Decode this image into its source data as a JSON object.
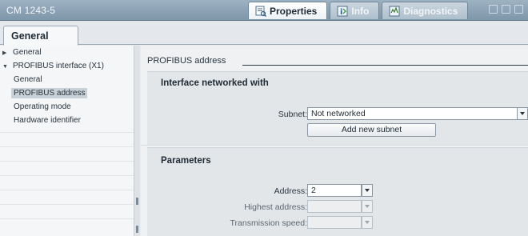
{
  "titlebar": {
    "module": "CM 1243-5",
    "tabs": [
      {
        "label": "Properties",
        "icon": "properties-icon",
        "active": true
      },
      {
        "label": "Info",
        "icon": "info-icon",
        "active": false
      },
      {
        "label": "Diagnostics",
        "icon": "diagnostics-icon",
        "active": false
      }
    ]
  },
  "tabstrip": {
    "general_tab": "General"
  },
  "nav": {
    "items": [
      {
        "label": "General",
        "level": 0,
        "arrow": "▶",
        "selected": false
      },
      {
        "label": "PROFIBUS interface (X1)",
        "level": 0,
        "arrow": "▼",
        "selected": false
      },
      {
        "label": "General",
        "level": 1,
        "selected": false
      },
      {
        "label": "PROFIBUS address",
        "level": 1,
        "selected": true
      },
      {
        "label": "Operating mode",
        "level": 1,
        "selected": false
      },
      {
        "label": "Hardware identifier",
        "level": 1,
        "selected": false
      }
    ]
  },
  "content": {
    "section_title": "PROFIBUS address",
    "networked": {
      "heading": "Interface networked with",
      "subnet_label": "Subnet:",
      "subnet_value": "Not networked",
      "add_button": "Add new subnet"
    },
    "parameters": {
      "heading": "Parameters",
      "address_label": "Address:",
      "address_value": "2",
      "highest_label": "Highest address:",
      "highest_value": "",
      "speed_label": "Transmission speed:",
      "speed_value": ""
    }
  },
  "colors": {
    "titlebar": "#8aa0b3",
    "selection": "#c9d1d8",
    "panel": "#e3e6e9"
  }
}
